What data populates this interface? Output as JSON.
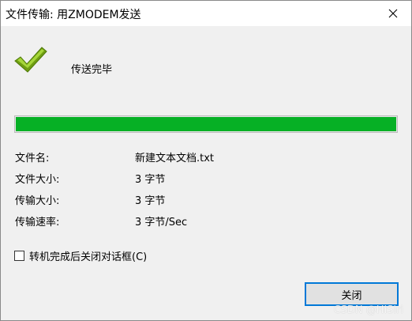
{
  "window": {
    "title": "文件传输: 用ZMODEM发送",
    "close_icon": "close-icon"
  },
  "status": {
    "icon": "checkmark-icon",
    "text": "传送完毕"
  },
  "progress": {
    "percent": 100,
    "color": "#06b025"
  },
  "details": [
    {
      "label": "文件名:",
      "value": "新建文本文档.txt"
    },
    {
      "label": "文件大小:",
      "value": "3 字节"
    },
    {
      "label": "传输大小:",
      "value": "3 字节"
    },
    {
      "label": "传输速率:",
      "value": "3 字节/Sec"
    }
  ],
  "auto_close": {
    "label": "转机完成后关闭对话框(C)",
    "checked": false
  },
  "buttons": {
    "close_label": "关闭"
  },
  "watermark": "CSDN @HiSiri"
}
